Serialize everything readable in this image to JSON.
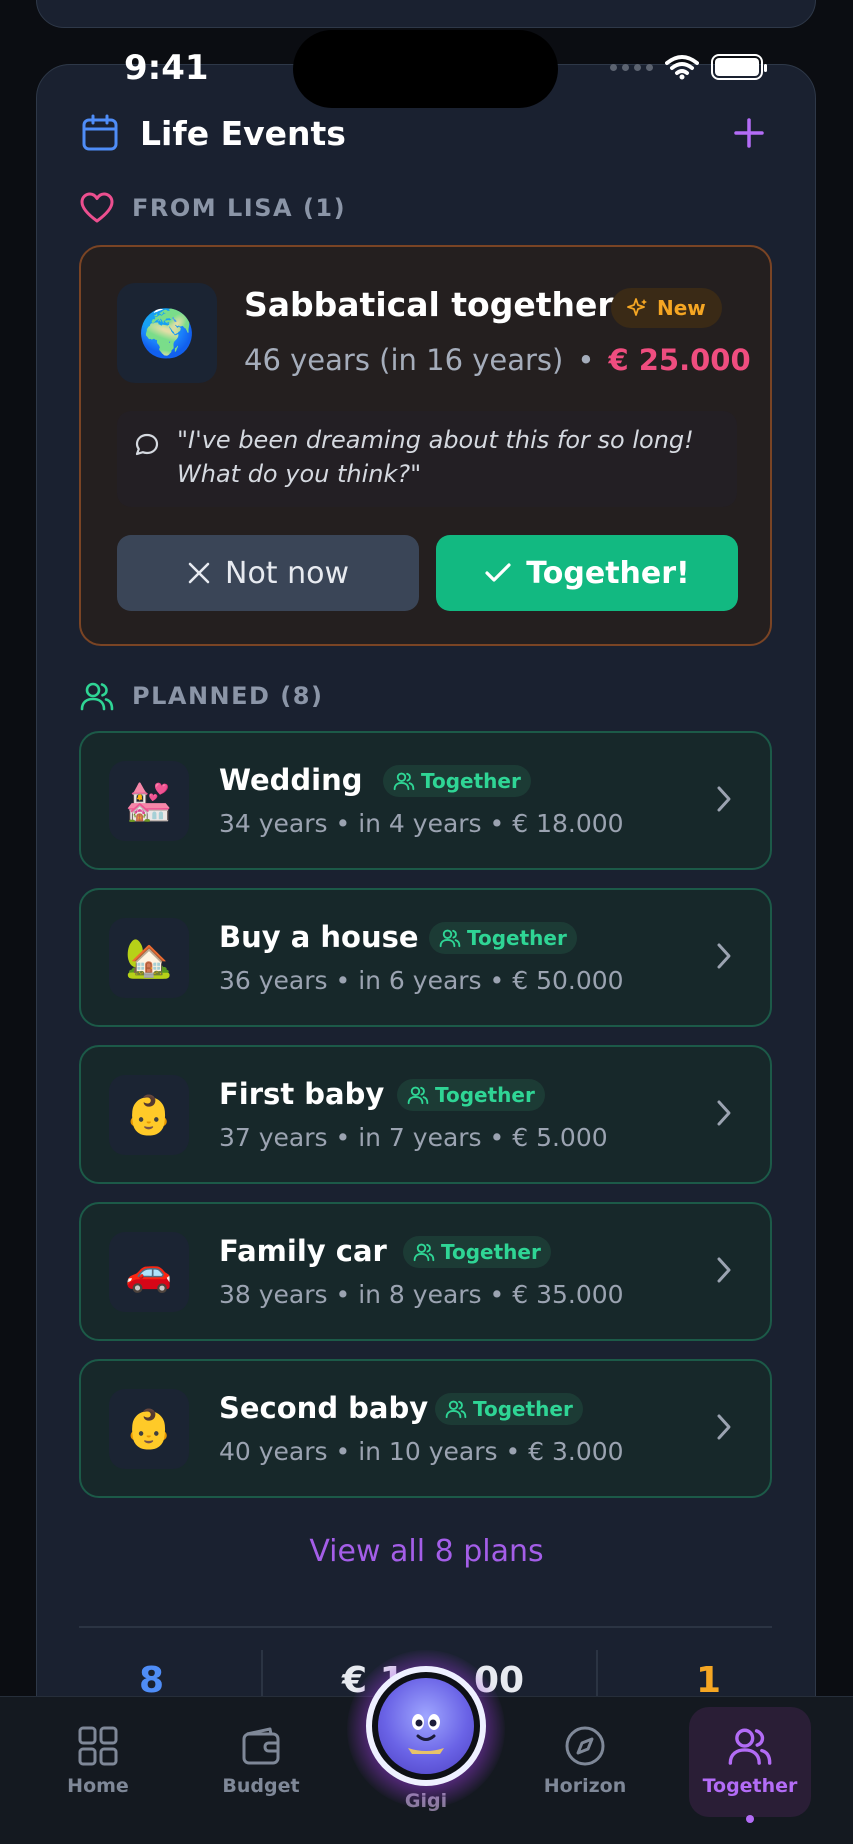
{
  "status_bar": {
    "time": "9:41"
  },
  "header": {
    "title": "Life Events"
  },
  "from_section": {
    "label": "FROM LISA (1)"
  },
  "proposal": {
    "emoji": "🌍",
    "title": "Sabbatical together",
    "badge": "New",
    "age_text": "46 years (in 16 years)",
    "separator": "•",
    "amount": "€ 25.000",
    "quote_line1": "\"I've been dreaming about this for so long!",
    "quote_line2": "What do you think?\"",
    "decline_label": "Not now",
    "accept_label": "Together!"
  },
  "planned_section": {
    "label": "PLANNED (8)"
  },
  "plans": [
    {
      "emoji": "💒",
      "title": "Wedding",
      "badge": "Together",
      "subtitle": "34 years • in 4 years • € 18.000"
    },
    {
      "emoji": "🏡",
      "title": "Buy a house",
      "badge": "Together",
      "subtitle": "36 years • in 6 years • € 50.000"
    },
    {
      "emoji": "👶",
      "title": "First baby",
      "badge": "Together",
      "subtitle": "37 years • in 7 years • € 5.000"
    },
    {
      "emoji": "🚗",
      "title": "Family car",
      "badge": "Together",
      "subtitle": "38 years • in 8 years • € 35.000"
    },
    {
      "emoji": "👶",
      "title": "Second baby",
      "badge": "Together",
      "subtitle": "40 years • in 10 years • € 3.000"
    }
  ],
  "view_all": "View all 8 plans",
  "stats": {
    "count": "8",
    "total_partial": "€ 1",
    "total_tail": "00",
    "pending": "1"
  },
  "tabbar": {
    "home": "Home",
    "budget": "Budget",
    "gigi": "Gigi",
    "horizon": "Horizon",
    "together": "Together"
  },
  "colors": {
    "accent_purple": "#b36cf6",
    "together_green": "#12b981",
    "amount_pink": "#ef4d7f",
    "new_badge_orange": "#f5a623"
  }
}
